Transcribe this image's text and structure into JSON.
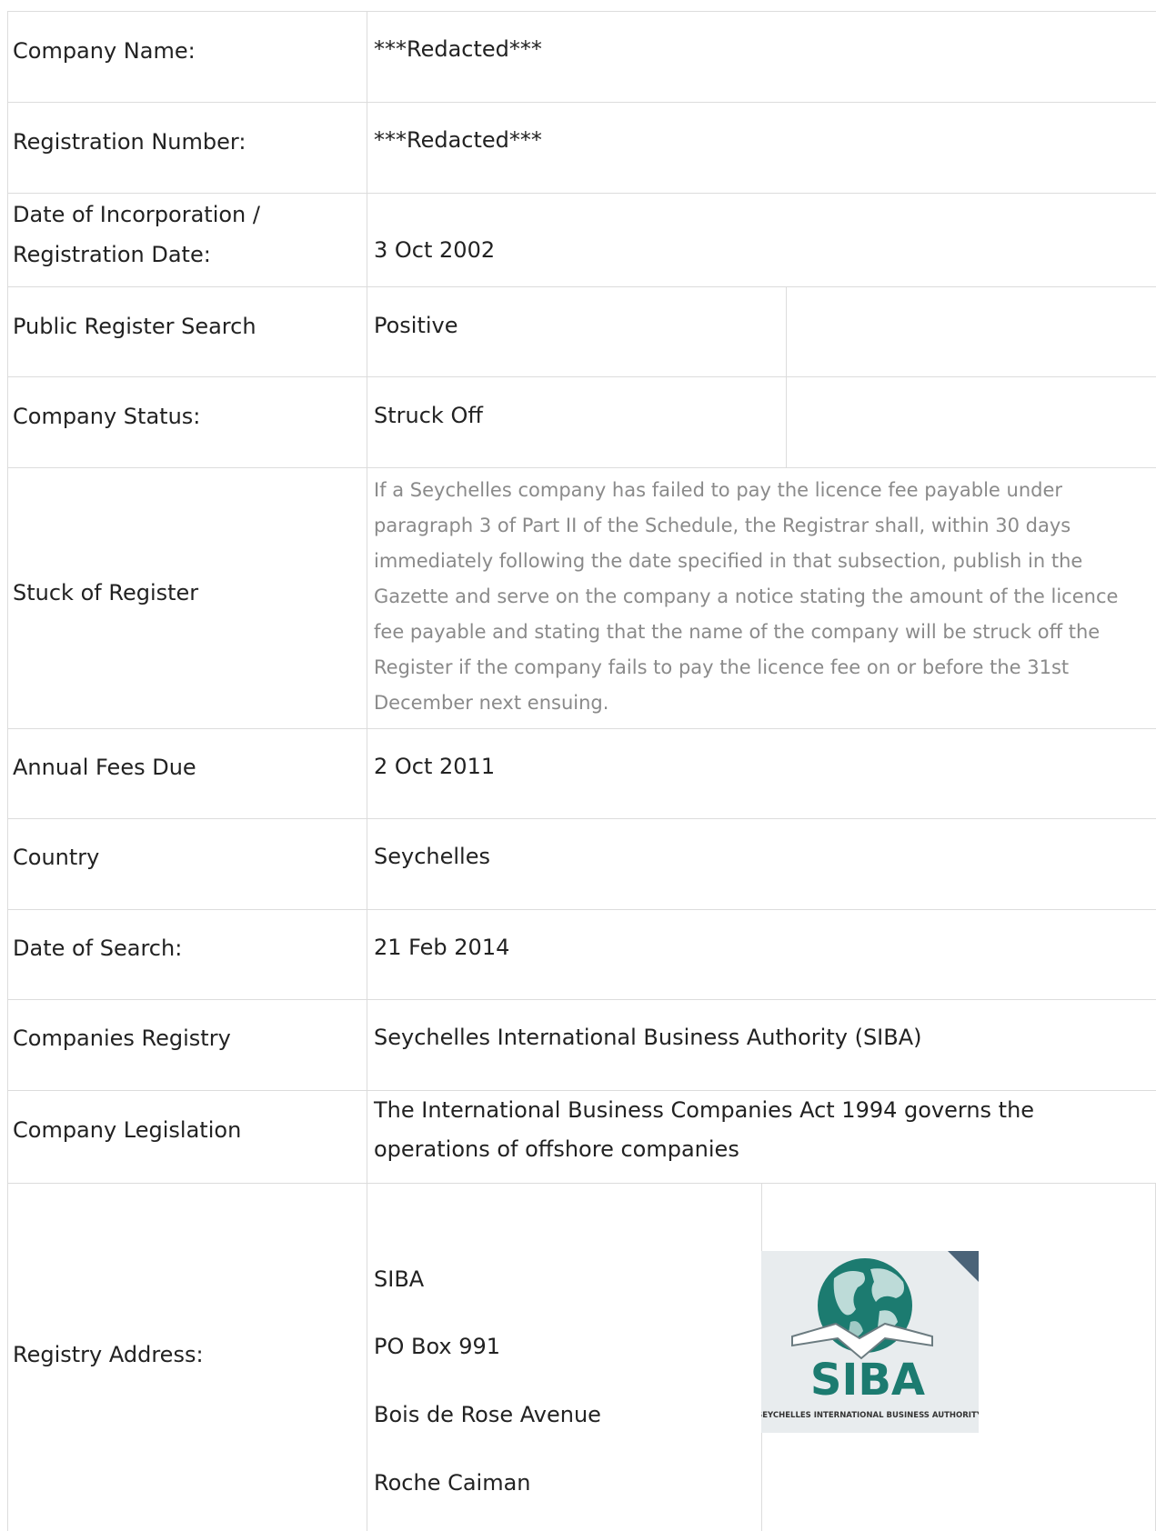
{
  "rows": {
    "company_name": {
      "label": "Company Name:",
      "value": "***Redacted***"
    },
    "registration_number": {
      "label": "Registration Number:",
      "value": "***Redacted***"
    },
    "incorporation": {
      "label_line1": "Date of Incorporation /",
      "label_line2": "Registration Date:",
      "value": "3 Oct 2002"
    },
    "public_register_search": {
      "label": "Public Register Search",
      "value": "Positive"
    },
    "company_status": {
      "label": "Company Status:",
      "value": "Struck Off"
    },
    "struck_of_register": {
      "label": "Stuck of Register",
      "lines": [
        "If a Seychelles company has failed to pay the licence fee payable under",
        "paragraph 3 of Part II of the Schedule, the Registrar shall, within 30 days",
        "immediately following the date specified in that subsection, publish in the",
        "Gazette and serve on the company a notice stating the amount of the licence",
        "fee payable and stating that the name of the company will be struck off the",
        "Register if the company fails to pay the licence fee on or before the 31st",
        "December next ensuing."
      ]
    },
    "annual_fees_due": {
      "label": "Annual Fees Due",
      "value": "2 Oct 2011"
    },
    "country": {
      "label": "Country",
      "value": "Seychelles"
    },
    "date_of_search": {
      "label": "Date of Search:",
      "value": "21 Feb 2014"
    },
    "companies_registry": {
      "label": "Companies Registry",
      "value": "Seychelles International Business Authority (SIBA)"
    },
    "company_legislation": {
      "label": "Company Legislation",
      "line1": "The International Business Companies Act 1994 governs the",
      "line2": "operations of offshore companies"
    },
    "registry_address": {
      "label": "Registry Address:",
      "lines": [
        "SIBA",
        "PO Box 991",
        "Bois de Rose Avenue",
        "Roche Caiman"
      ]
    }
  },
  "logo": {
    "wordmark": "SIBA",
    "tagline": "SEYCHELLES INTERNATIONAL BUSINESS AUTHORITY",
    "colors": {
      "teal": "#1c7b70",
      "corner": "#4a6378",
      "background": "#e8ecee"
    }
  }
}
